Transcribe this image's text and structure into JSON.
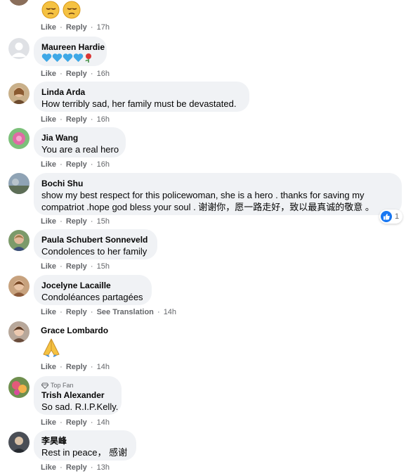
{
  "colors": {
    "bubble": "#f0f2f5",
    "meta": "#65676b",
    "like_blue": "#1877f2",
    "text": "#050505"
  },
  "labels": {
    "like": "Like",
    "reply": "Reply",
    "see_translation": "See Translation",
    "dot": "·",
    "top_fan": "Top Fan"
  },
  "comments": [
    {
      "author": "",
      "text": "",
      "emoji": [
        "pensive-face",
        "pensive-face"
      ],
      "time": "17h"
    },
    {
      "author": "Maureen Hardie",
      "text": "",
      "emoji": [
        "blue-heart",
        "blue-heart",
        "blue-heart",
        "blue-heart",
        "rose"
      ],
      "time": "16h"
    },
    {
      "author": "Linda Arda",
      "text": "How terribly sad, her family must be devastated.",
      "time": "16h"
    },
    {
      "author": "Jia Wang",
      "text": "You are a real hero",
      "time": "16h"
    },
    {
      "author": "Bochi Shu",
      "text_lines": [
        "show my best respect for this policewoman, she is a hero . thanks for saving my",
        "compatriot .hope god bless your soul . 谢谢你，愿一路走好，致以最真诚的敬意 。"
      ],
      "time": "15h",
      "reaction": {
        "icon": "like-icon",
        "count": "1"
      }
    },
    {
      "author": "Paula Schubert Sonneveld",
      "text": "Condolences to her family",
      "time": "15h"
    },
    {
      "author": "Jocelyne Lacaille",
      "text": "Condoléances partagées",
      "time": "14h"
    },
    {
      "author": "Grace Lombardo",
      "text": "",
      "emoji": [
        "folded-hands"
      ],
      "time": "14h"
    },
    {
      "author": "Trish Alexander",
      "badge": "Top Fan",
      "text": "So sad. R.I.P.Kelly.",
      "time": "14h"
    },
    {
      "author": "李昊峰",
      "text": "Rest in peace， 感谢",
      "time": "13h"
    }
  ]
}
